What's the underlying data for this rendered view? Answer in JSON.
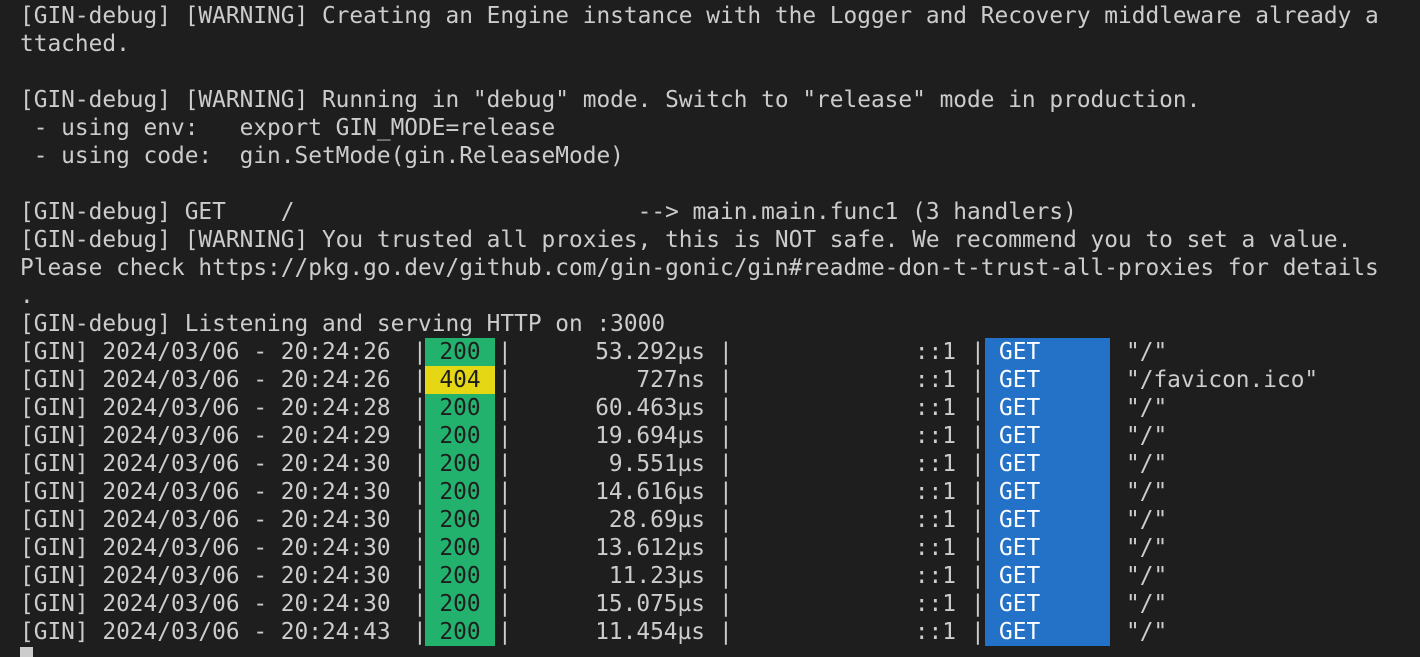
{
  "terminal": {
    "lines": [
      "[GIN-debug] [WARNING] Creating an Engine instance with the Logger and Recovery middleware already a",
      "ttached.",
      "",
      "[GIN-debug] [WARNING] Running in \"debug\" mode. Switch to \"release\" mode in production.",
      " - using env:   export GIN_MODE=release",
      " - using code:  gin.SetMode(gin.ReleaseMode)",
      "",
      "[GIN-debug] GET    /                         --> main.main.func1 (3 handlers)",
      "[GIN-debug] [WARNING] You trusted all proxies, this is NOT safe. We recommend you to set a value.",
      "Please check https://pkg.go.dev/github.com/gin-gonic/gin#readme-don-t-trust-all-proxies for details",
      ".",
      "[GIN-debug] Listening and serving HTTP on :3000"
    ],
    "separator": "|",
    "requests": [
      {
        "prefix": "[GIN] 2024/03/06 - 20:24:26",
        "status": "200",
        "status_color": "#23b26e",
        "latency": "53.292µs",
        "client": "::1",
        "method": "GET",
        "path": "\"/\""
      },
      {
        "prefix": "[GIN] 2024/03/06 - 20:24:26",
        "status": "404",
        "status_color": "#e5d713",
        "latency": "727ns",
        "client": "::1",
        "method": "GET",
        "path": "\"/favicon.ico\""
      },
      {
        "prefix": "[GIN] 2024/03/06 - 20:24:28",
        "status": "200",
        "status_color": "#23b26e",
        "latency": "60.463µs",
        "client": "::1",
        "method": "GET",
        "path": "\"/\""
      },
      {
        "prefix": "[GIN] 2024/03/06 - 20:24:29",
        "status": "200",
        "status_color": "#23b26e",
        "latency": "19.694µs",
        "client": "::1",
        "method": "GET",
        "path": "\"/\""
      },
      {
        "prefix": "[GIN] 2024/03/06 - 20:24:30",
        "status": "200",
        "status_color": "#23b26e",
        "latency": "9.551µs",
        "client": "::1",
        "method": "GET",
        "path": "\"/\""
      },
      {
        "prefix": "[GIN] 2024/03/06 - 20:24:30",
        "status": "200",
        "status_color": "#23b26e",
        "latency": "14.616µs",
        "client": "::1",
        "method": "GET",
        "path": "\"/\""
      },
      {
        "prefix": "[GIN] 2024/03/06 - 20:24:30",
        "status": "200",
        "status_color": "#23b26e",
        "latency": "28.69µs",
        "client": "::1",
        "method": "GET",
        "path": "\"/\""
      },
      {
        "prefix": "[GIN] 2024/03/06 - 20:24:30",
        "status": "200",
        "status_color": "#23b26e",
        "latency": "13.612µs",
        "client": "::1",
        "method": "GET",
        "path": "\"/\""
      },
      {
        "prefix": "[GIN] 2024/03/06 - 20:24:30",
        "status": "200",
        "status_color": "#23b26e",
        "latency": "11.23µs",
        "client": "::1",
        "method": "GET",
        "path": "\"/\""
      },
      {
        "prefix": "[GIN] 2024/03/06 - 20:24:30",
        "status": "200",
        "status_color": "#23b26e",
        "latency": "15.075µs",
        "client": "::1",
        "method": "GET",
        "path": "\"/\""
      },
      {
        "prefix": "[GIN] 2024/03/06 - 20:24:43",
        "status": "200",
        "status_color": "#23b26e",
        "latency": "11.454µs",
        "client": "::1",
        "method": "GET",
        "path": "\"/\""
      }
    ],
    "method_color": "#2472c8"
  }
}
